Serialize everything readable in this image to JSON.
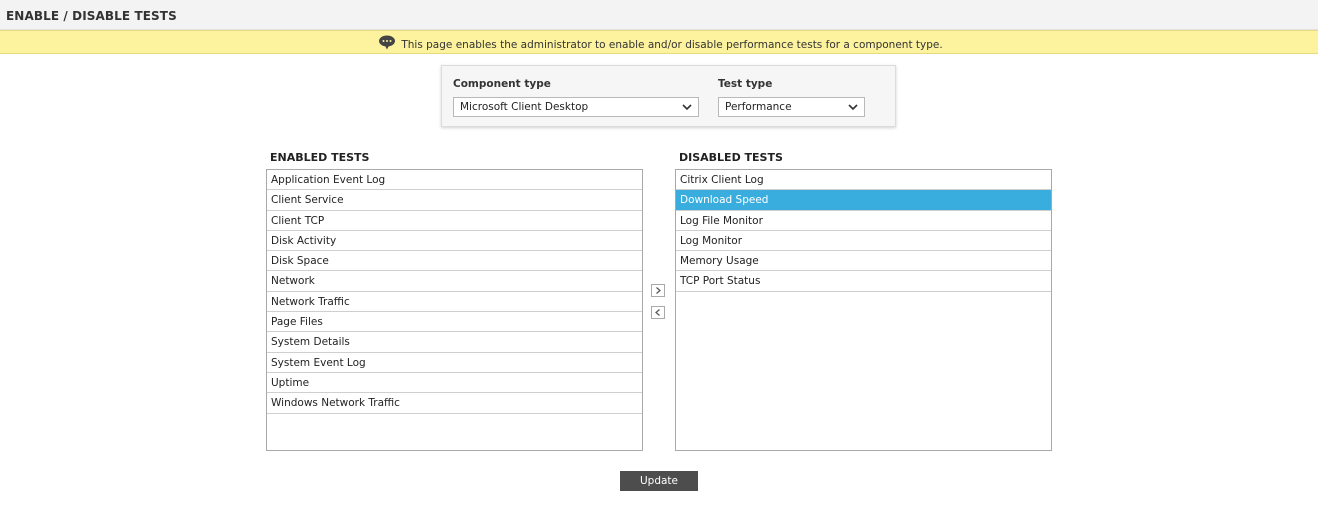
{
  "page": {
    "title": "ENABLE / DISABLE TESTS"
  },
  "info": {
    "icon": "speech-bubble-icon",
    "message": "This page enables the administrator to enable and/or disable performance tests for a component type."
  },
  "filters": {
    "component_type": {
      "label": "Component type",
      "value": "Microsoft Client Desktop"
    },
    "test_type": {
      "label": "Test type",
      "value": "Performance"
    }
  },
  "enabled": {
    "heading": "ENABLED TESTS",
    "items": [
      "Application Event Log",
      "Client Service",
      "Client TCP",
      "Disk Activity",
      "Disk Space",
      "Network",
      "Network Traffic",
      "Page Files",
      "System Details",
      "System Event Log",
      "Uptime",
      "Windows Network Traffic"
    ]
  },
  "disabled": {
    "heading": "DISABLED TESTS",
    "items": [
      "Citrix Client Log",
      "Download Speed",
      "Log File Monitor",
      "Log Monitor",
      "Memory Usage",
      "TCP Port Status"
    ],
    "selected_index": 1
  },
  "move_buttons": {
    "to_disabled_icon": "chevron-right-icon",
    "to_enabled_icon": "chevron-left-icon"
  },
  "actions": {
    "update_label": "Update"
  },
  "colors": {
    "info_bar": "#fdf39f",
    "selected_row": "#3aaddf",
    "update_button": "#4d4d4d"
  }
}
